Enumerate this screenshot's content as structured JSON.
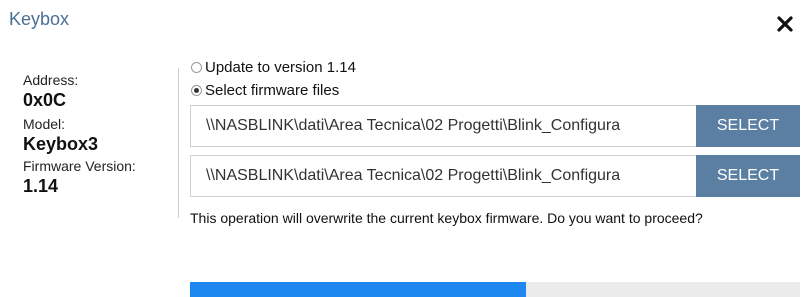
{
  "dialog": {
    "title": "Keybox"
  },
  "device": {
    "address_label": "Address:",
    "address_value": "0x0C",
    "model_label": "Model:",
    "model_value": "Keybox3",
    "firmware_label": "Firmware Version:",
    "firmware_value": "1.14"
  },
  "options": {
    "update_label": "Update to version 1.14",
    "select_files_label": "Select firmware files",
    "selected": "select_files"
  },
  "files": [
    {
      "path": "\\\\NASBLINK\\dati\\Area Tecnica\\02 Progetti\\Blink_Configura",
      "button_label": "SELECT"
    },
    {
      "path": "\\\\NASBLINK\\dati\\Area Tecnica\\02 Progetti\\Blink_Configura",
      "button_label": "SELECT"
    }
  ],
  "warning": "This operation will overwrite the current keybox firmware. Do you want to proceed?",
  "progress": {
    "fraction": 0.55
  },
  "colors": {
    "title": "#4a6f96",
    "select_button": "#5b7fa3",
    "progress_fill": "#1e88f0",
    "progress_track": "#ebebeb"
  }
}
